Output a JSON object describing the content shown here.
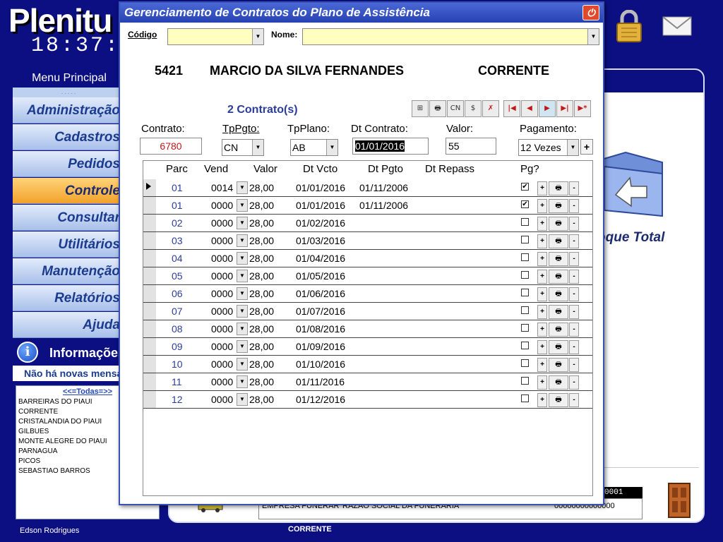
{
  "app": {
    "title": "Plenitu",
    "clock": "18:37:",
    "icons": {
      "lock": "lock-icon",
      "mail": "mail-icon"
    }
  },
  "menu": {
    "header": "Menu Principal",
    "dots": ".....",
    "items": [
      {
        "label": "Administração",
        "active": false
      },
      {
        "label": "Cadastros",
        "active": false
      },
      {
        "label": "Pedidos",
        "active": false
      },
      {
        "label": "Controle",
        "active": true
      },
      {
        "label": "Consultar",
        "active": false
      },
      {
        "label": "Utilitários",
        "active": false
      },
      {
        "label": "Manutenção",
        "active": false
      },
      {
        "label": "Relatórios",
        "active": false
      },
      {
        "label": "Ajuda",
        "active": false
      }
    ]
  },
  "info": {
    "icon_glyph": "i",
    "title": "Informações",
    "message": "Não há novas mensagens"
  },
  "cities": {
    "filter": "<<=Todas=>>",
    "items": [
      "BARREIRAS DO PIAUI",
      "CORRENTE",
      "CRISTALANDIA DO PIAUI",
      "GILBUES",
      "MONTE ALEGRE DO PIAUI",
      "PARNAGUA",
      "PICOS",
      "SEBASTIAO BARROS"
    ]
  },
  "footer": {
    "user": "Edson Rodrigues",
    "status": "CORRENTE"
  },
  "background_panel": {
    "estoque": "oque Total",
    "bottom_col1": "EMPRESA FUNERAR",
    "bottom_col2": "RAZAO SOCIAL DA FUNERARIA",
    "bottom_col3": "00000000000000",
    "code": "0001"
  },
  "dialog": {
    "title": "Gerenciamento de Contratos do Plano de Assistência",
    "close_glyph": "⏻",
    "codigo_label": "Código",
    "nome_label": "Nome:",
    "codigo_value": "",
    "nome_value": "",
    "client_id": "5421",
    "client_name": "MARCIO DA SILVA FERNANDES",
    "client_city": "CORRENTE",
    "contracts_count": "2 Contrato(s)",
    "toolbar": {
      "tree": "⊞",
      "print": "🖶",
      "cn": "CN",
      "dollar": "$",
      "delete": "✗",
      "first": "|◀",
      "prev": "◀",
      "next": "▶",
      "last": "▶|",
      "new": "▶*"
    },
    "fields": {
      "contrato_label": "Contrato:",
      "contrato_value": "6780",
      "tppgto_label": "TpPgto:",
      "tppgto_value": "CN",
      "tpplano_label": "TpPlano:",
      "tpplano_value": "AB",
      "dtcontrato_label": "Dt Contrato:",
      "dtcontrato_value": "01/01/2016",
      "valor_label": "Valor:",
      "valor_value": "55",
      "pagamento_label": "Pagamento:",
      "pagamento_value": "12 Vezes",
      "plus": "+"
    },
    "grid": {
      "headers": {
        "parc": "Parc",
        "vend": "Vend",
        "valor": "Valor",
        "vcto": "Dt Vcto",
        "pgto": "Dt Pgto",
        "repass": "Dt Repass",
        "pg": "Pg?"
      },
      "buttons": {
        "plus": "+",
        "print": "🖶",
        "minus": "-"
      },
      "rows": [
        {
          "parc": "01",
          "vend": "0014",
          "valor": "28,00",
          "vcto": "01/01/2016",
          "pgto": "01/11/2006",
          "pg": "✔"
        },
        {
          "parc": "01",
          "vend": "0000",
          "valor": "28,00",
          "vcto": "01/01/2016",
          "pgto": "01/11/2006",
          "pg": "✔"
        },
        {
          "parc": "02",
          "vend": "0000",
          "valor": "28,00",
          "vcto": "01/02/2016",
          "pgto": "",
          "pg": ""
        },
        {
          "parc": "03",
          "vend": "0000",
          "valor": "28,00",
          "vcto": "01/03/2016",
          "pgto": "",
          "pg": ""
        },
        {
          "parc": "04",
          "vend": "0000",
          "valor": "28,00",
          "vcto": "01/04/2016",
          "pgto": "",
          "pg": ""
        },
        {
          "parc": "05",
          "vend": "0000",
          "valor": "28,00",
          "vcto": "01/05/2016",
          "pgto": "",
          "pg": ""
        },
        {
          "parc": "06",
          "vend": "0000",
          "valor": "28,00",
          "vcto": "01/06/2016",
          "pgto": "",
          "pg": ""
        },
        {
          "parc": "07",
          "vend": "0000",
          "valor": "28,00",
          "vcto": "01/07/2016",
          "pgto": "",
          "pg": ""
        },
        {
          "parc": "08",
          "vend": "0000",
          "valor": "28,00",
          "vcto": "01/08/2016",
          "pgto": "",
          "pg": ""
        },
        {
          "parc": "09",
          "vend": "0000",
          "valor": "28,00",
          "vcto": "01/09/2016",
          "pgto": "",
          "pg": ""
        },
        {
          "parc": "10",
          "vend": "0000",
          "valor": "28,00",
          "vcto": "01/10/2016",
          "pgto": "",
          "pg": ""
        },
        {
          "parc": "11",
          "vend": "0000",
          "valor": "28,00",
          "vcto": "01/11/2016",
          "pgto": "",
          "pg": ""
        },
        {
          "parc": "12",
          "vend": "0000",
          "valor": "28,00",
          "vcto": "01/12/2016",
          "pgto": "",
          "pg": ""
        }
      ]
    }
  },
  "colors": {
    "background": "#0b0f82",
    "accent_orange": "#f2a22a",
    "input_yellow": "#ffffc0",
    "title_blue": "#2742b3",
    "red_value": "#c01818"
  }
}
